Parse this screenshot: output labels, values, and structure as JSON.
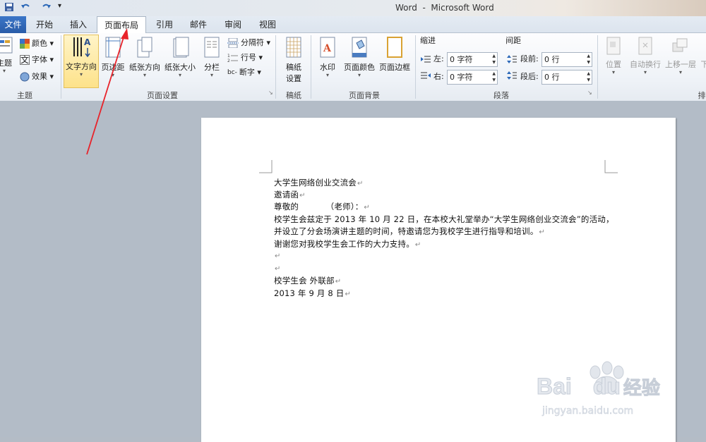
{
  "window": {
    "title": "Word  -  Microsoft Word"
  },
  "tabs": [
    {
      "label": "文件"
    },
    {
      "label": "开始"
    },
    {
      "label": "插入"
    },
    {
      "label": "页面布局"
    },
    {
      "label": "引用"
    },
    {
      "label": "邮件"
    },
    {
      "label": "审阅"
    },
    {
      "label": "视图"
    }
  ],
  "ribbon": {
    "theme": {
      "theme_btn": "主题",
      "colors": "颜色",
      "fonts": "字体",
      "effects": "效果",
      "group": "主题"
    },
    "page_setup": {
      "text_direction": "文字方向",
      "margins": "页边距",
      "orientation": "纸张方向",
      "size": "纸张大小",
      "columns": "分栏",
      "breaks": "分隔符",
      "line_numbers": "行号",
      "hyphenation": "断字",
      "group": "页面设置"
    },
    "manuscript": {
      "label1": "稿纸",
      "label2": "设置",
      "group": "稿纸"
    },
    "background": {
      "watermark": "水印",
      "page_color": "页面颜色",
      "page_borders": "页面边框",
      "group": "页面背景"
    },
    "paragraph": {
      "indent_header": "缩进",
      "left_label": "左:",
      "left_value": "0 字符",
      "right_label": "右:",
      "right_value": "0 字符",
      "spacing_header": "间距",
      "before_label": "段前:",
      "before_value": "0 行",
      "after_label": "段后:",
      "after_value": "0 行",
      "group": "段落"
    },
    "arrange": {
      "position": "位置",
      "wrap": "自动换行",
      "bring_forward": "上移一层",
      "more": "下",
      "group": "排"
    }
  },
  "document": {
    "lines": [
      "大学生网络创业交流会",
      "邀请函",
      "尊敬的          （老师）：",
      "校学生会兹定于 2013 年 10 月 22 日，在本校大礼堂举办“大学生网络创业交流会”的活动，",
      "并设立了分会场演讲主题的时间，特邀请您为我校学生进行指导和培训。",
      "谢谢您对我校学生会工作的大力支持。",
      "",
      "",
      "校学生会 外联部",
      "2013 年 9 月 8 日"
    ],
    "para_mark": "↵"
  },
  "watermark": {
    "brand": "Bai",
    "brand2": "du",
    "cn": "经验",
    "url": "jingyan.baidu.com"
  },
  "colors": {
    "accent": "#2a5ca8",
    "arrow": "#e8232a",
    "selected": "#fde58f"
  }
}
